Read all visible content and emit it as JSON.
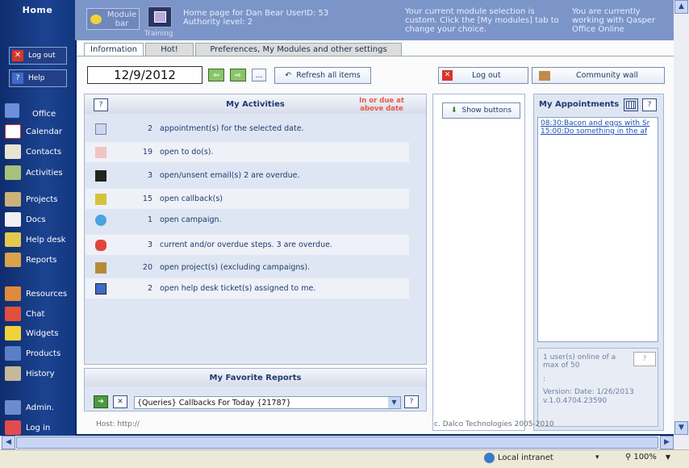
{
  "nav": {
    "home": "Home",
    "logout": "Log out",
    "help": "Help",
    "items": [
      "Office",
      "Calendar",
      "Contacts",
      "Activities",
      "Projects",
      "Docs",
      "Help desk",
      "Reports",
      "Resources",
      "Chat",
      "Widgets",
      "Products",
      "History",
      "Admin.",
      "Log in"
    ]
  },
  "header": {
    "module_bar": "Module bar",
    "training": "Training",
    "home_page": "Home page for Dan Bear UserID: 53",
    "authority": "Authority level: 2",
    "selection": "Your current module selection is custom. Click the [My modules] tab to change your choice.",
    "working": "You are currently working with Qasper Office Online"
  },
  "tabs": [
    "Information",
    "Hot!",
    "Preferences, My Modules and other settings"
  ],
  "toolbar": {
    "date": "12/9/2012",
    "ellipsis": "...",
    "refresh": "Refresh all items",
    "logout": "Log out",
    "community": "Community wall",
    "show_buttons": "Show buttons"
  },
  "activities": {
    "title": "My Activities",
    "due_note": "In or due at above date",
    "help": "?",
    "rows": [
      {
        "count": "2",
        "text": "appointment(s) for the selected date."
      },
      {
        "count": "19",
        "text": "open to do(s)."
      },
      {
        "count": "3",
        "text": "open/unsent email(s) 2 are overdue."
      },
      {
        "count": "15",
        "text": "open callback(s)"
      },
      {
        "count": "1",
        "text": "open campaign."
      },
      {
        "count": "3",
        "text": "current and/or overdue steps. 3 are overdue."
      },
      {
        "count": "20",
        "text": "open project(s) (excluding campaigns)."
      },
      {
        "count": "2",
        "text": "open help desk ticket(s) assigned to me."
      }
    ]
  },
  "appointments": {
    "title": "My Appointments",
    "help": "?",
    "items": [
      "08:30:Bacon and eggs with Sr",
      "15:00:Do something in the af"
    ],
    "online": "1 user(s) online of a max of 50",
    "colon": ":",
    "version": "Version: Date: 1/26/2013 v.1.0.4704.23590"
  },
  "reports": {
    "title": "My Favorite Reports",
    "selected": "{Queries} Callbacks For Today {21787}",
    "help": "?"
  },
  "footer": {
    "host": "Host: http://",
    "copyright": "c. Dalco Technologies 2005-2010"
  },
  "status": {
    "zone": "Local intranet",
    "zoom": "100%"
  },
  "colors": {
    "nav_bg": "#1c4390",
    "header_bg": "#7c95c8",
    "panel_bg": "#dfe6f3",
    "due_note": "#e8584a"
  }
}
